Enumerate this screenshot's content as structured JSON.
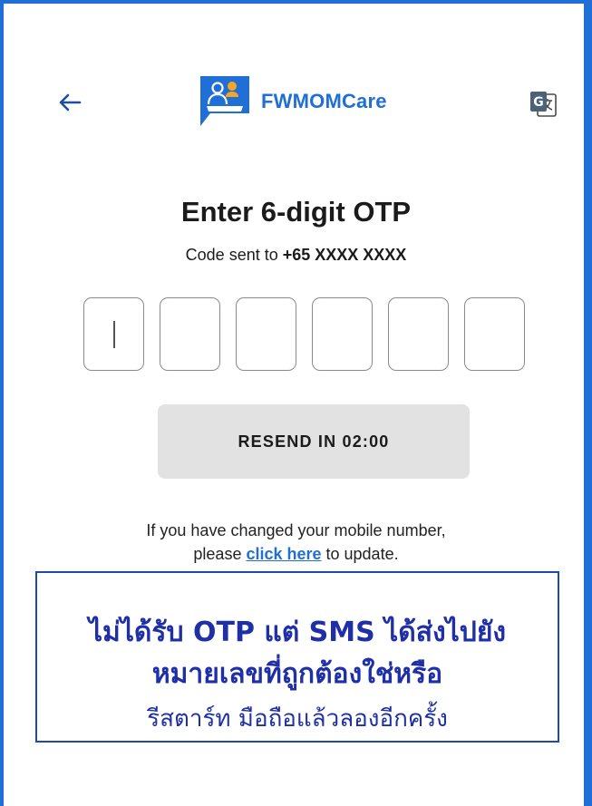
{
  "app": {
    "brand_name": "FWMOMCare",
    "brand_color": "#1f6fd6"
  },
  "header": {
    "back_icon": "arrow-left-icon",
    "translate_icon": "google-translate-icon"
  },
  "otp": {
    "title": "Enter 6-digit OTP",
    "code_sent_prefix": "Code sent to ",
    "phone": "+65 XXXX XXXX",
    "digits": [
      "",
      "",
      "",
      "",
      "",
      ""
    ]
  },
  "resend": {
    "label": "RESEND IN 02:00"
  },
  "note": {
    "line1": "If you have changed your mobile number,",
    "pre_link": "please ",
    "link": "click here",
    "post_link": " to update."
  },
  "callout": {
    "line1": "ไม่ได้รับ OTP แต่ SMS ได้ส่งไปยัง",
    "line2": "หมายเลขที่ถูกต้องใช่หรือ",
    "line3": "รีสตาร์ท มือถือแล้วลองอีกครั้ง",
    "text_color": "#1f2fa8",
    "border_color": "#1f4aa6"
  }
}
